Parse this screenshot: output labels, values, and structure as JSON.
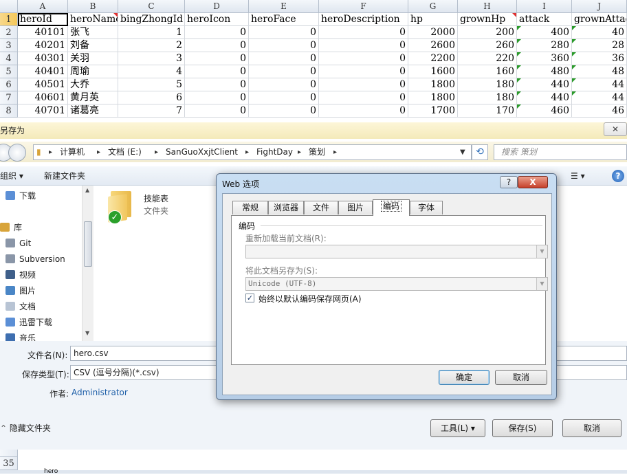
{
  "sheet": {
    "columns": [
      "A",
      "B",
      "C",
      "D",
      "E",
      "F",
      "G",
      "H",
      "I",
      "J"
    ],
    "headers": [
      "heroId",
      "heroName",
      "bingZhongId",
      "heroIcon",
      "heroFace",
      "heroDescription",
      "hp",
      "grownHp",
      "attack",
      "grownAttack"
    ],
    "row_numbers": [
      "1",
      "2",
      "3",
      "4",
      "5",
      "6",
      "7",
      "8"
    ],
    "rows": [
      [
        "40101",
        "张飞",
        "1",
        "0",
        "0",
        "0",
        "2000",
        "200",
        "400",
        "40"
      ],
      [
        "40201",
        "刘备",
        "2",
        "0",
        "0",
        "0",
        "2600",
        "260",
        "280",
        "28"
      ],
      [
        "40301",
        "关羽",
        "3",
        "0",
        "0",
        "0",
        "2200",
        "220",
        "360",
        "36"
      ],
      [
        "40401",
        "周瑜",
        "4",
        "0",
        "0",
        "0",
        "1600",
        "160",
        "480",
        "48"
      ],
      [
        "40501",
        "大乔",
        "5",
        "0",
        "0",
        "0",
        "1800",
        "180",
        "440",
        "44"
      ],
      [
        "40601",
        "黄月英",
        "6",
        "0",
        "0",
        "0",
        "1800",
        "180",
        "440",
        "44"
      ],
      [
        "40701",
        "诸葛亮",
        "7",
        "0",
        "0",
        "0",
        "1700",
        "170",
        "460",
        "46"
      ]
    ],
    "footer_row_number": "35",
    "sheet_tab": "hero"
  },
  "save_as": {
    "title": "另存为",
    "close": "✕",
    "breadcrumbs": [
      "计算机",
      "文档 (E:)",
      "SanGuoXxjtClient",
      "FightDay",
      "策划"
    ],
    "search_placeholder": "搜索 策划",
    "toolbar": {
      "organize": "组织 ▾",
      "new_folder": "新建文件夹",
      "help": "?"
    },
    "nav_items": [
      {
        "label": "下载",
        "icon": "download-folder-icon",
        "color": "#5b8fd6"
      },
      {
        "label": "库",
        "icon": "library-icon",
        "color": "#d8a43a"
      },
      {
        "label": "Git",
        "icon": "git-icon",
        "color": "#8a96a8"
      },
      {
        "label": "Subversion",
        "icon": "subversion-icon",
        "color": "#8a96a8"
      },
      {
        "label": "视频",
        "icon": "video-icon",
        "color": "#3f5f8a"
      },
      {
        "label": "图片",
        "icon": "picture-icon",
        "color": "#4a86c6"
      },
      {
        "label": "文档",
        "icon": "document-icon",
        "color": "#b8c4d4"
      },
      {
        "label": "迅雷下载",
        "icon": "thunder-download-icon",
        "color": "#5b8fd6"
      },
      {
        "label": "音乐",
        "icon": "music-icon",
        "color": "#3f6fb0"
      }
    ],
    "file": {
      "name": "技能表",
      "type": "文件夹"
    },
    "filename_label": "文件名(N):",
    "filename_value": "hero.csv",
    "filetype_label": "保存类型(T):",
    "filetype_value": "CSV (逗号分隔)(*.csv)",
    "author_label": "作者:",
    "author_value": "Administrator",
    "hide_folders": "隐藏文件夹",
    "tools_button": "工具(L)",
    "save_button": "保存(S)",
    "cancel_button": "取消"
  },
  "web_options": {
    "title": "Web 选项",
    "help": "?",
    "close": "X",
    "tabs": [
      "常规",
      "浏览器",
      "文件",
      "图片",
      "编码",
      "字体"
    ],
    "active_tab": "编码",
    "group_title": "编码",
    "reload_label": "重新加载当前文档(R):",
    "reload_value": "",
    "save_as_label": "将此文档另存为(S):",
    "save_as_value": "Unicode (UTF-8)",
    "always_save_label": "始终以默认编码保存网页(A)",
    "always_save_checked": true,
    "ok_button": "确定",
    "cancel_button": "取消"
  }
}
